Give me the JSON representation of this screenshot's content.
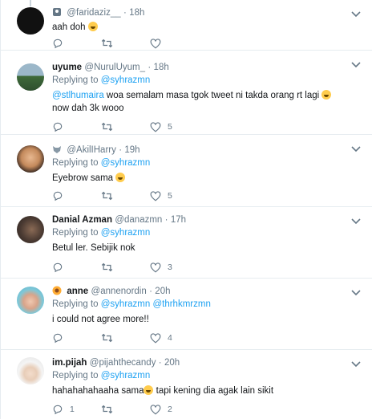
{
  "tweets": [
    {
      "name": "",
      "handle": "@faridaziz__",
      "time": "18h",
      "replying_label": "",
      "replying_to": "",
      "mention_prefix": "",
      "text": "aah doh",
      "emoji_after": true,
      "text_tail": "",
      "reply_count": "",
      "retweet_count": "",
      "like_count": ""
    },
    {
      "name": "uyume",
      "handle": "@NurulUyum_",
      "time": "18h",
      "replying_label": "Replying to",
      "replying_to": "@syhrazmn",
      "mention_prefix": "@stlhumaira",
      "text": " woa semalam masa tgok tweet ni takda orang rt lagi ",
      "emoji_after": true,
      "text_tail": " now dah 3k wooo",
      "reply_count": "",
      "retweet_count": "",
      "like_count": "5"
    },
    {
      "name": "",
      "handle": "@AkilIHarry",
      "time": "19h",
      "replying_label": "Replying to",
      "replying_to": "@syhrazmn",
      "mention_prefix": "",
      "text": "Eyebrow sama ",
      "emoji_after": true,
      "text_tail": "",
      "reply_count": "",
      "retweet_count": "",
      "like_count": "5"
    },
    {
      "name": "Danial Azman",
      "handle": "@danazmn",
      "time": "17h",
      "replying_label": "Replying to",
      "replying_to": "@syhrazmn",
      "mention_prefix": "",
      "text": "Betul ler. Sebijik nok",
      "emoji_after": false,
      "text_tail": "",
      "reply_count": "",
      "retweet_count": "",
      "like_count": "3"
    },
    {
      "name": "anne",
      "handle": "@annenordin",
      "time": "20h",
      "replying_label": "Replying to",
      "replying_to": "@syhrazmn @thrhkmrzmn",
      "mention_prefix": "",
      "text": "i could not agree more!!",
      "emoji_after": false,
      "text_tail": "",
      "reply_count": "",
      "retweet_count": "",
      "like_count": "4"
    },
    {
      "name": "im.pijah",
      "handle": "@pijahthecandy",
      "time": "20h",
      "replying_label": "Replying to",
      "replying_to": "@syhrazmn",
      "mention_prefix": "",
      "text": "hahahahahaaha sama",
      "emoji_after": true,
      "text_tail": " tapi kening dia agak lain sikit",
      "reply_count": "1",
      "retweet_count": "",
      "like_count": "2"
    }
  ],
  "separator": "·",
  "colors": {
    "link": "#1da1f2",
    "muted": "#657786",
    "border": "#e6ecf0"
  },
  "icons": [
    "reply-icon",
    "retweet-icon",
    "like-icon",
    "chevron-down-icon",
    "tears-of-joy-emoji"
  ]
}
